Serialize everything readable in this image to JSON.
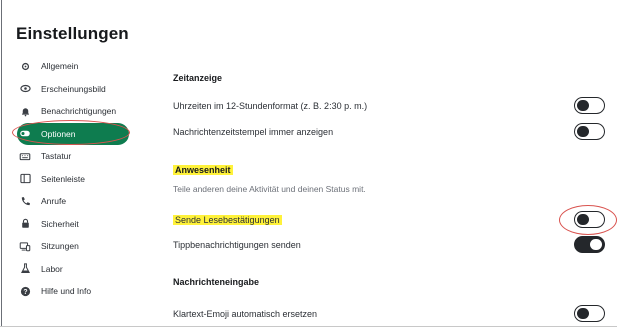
{
  "title": "Einstellungen",
  "nav": [
    {
      "label": "Allgemein",
      "icon": "gear-icon",
      "active": false
    },
    {
      "label": "Erscheinungsbild",
      "icon": "eye-icon",
      "active": false
    },
    {
      "label": "Benachrichtigungen",
      "icon": "bell-icon",
      "active": false
    },
    {
      "label": "Optionen",
      "icon": "toggle-icon",
      "active": true
    },
    {
      "label": "Tastatur",
      "icon": "keyboard-icon",
      "active": false
    },
    {
      "label": "Seitenleiste",
      "icon": "sidebar-icon",
      "active": false
    },
    {
      "label": "Anrufe",
      "icon": "phone-icon",
      "active": false
    },
    {
      "label": "Sicherheit",
      "icon": "lock-icon",
      "active": false
    },
    {
      "label": "Sitzungen",
      "icon": "devices-icon",
      "active": false
    },
    {
      "label": "Labor",
      "icon": "flask-icon",
      "active": false
    },
    {
      "label": "Hilfe und Info",
      "icon": "help-icon",
      "active": false
    }
  ],
  "sections": {
    "zeitanzeige": {
      "title": "Zeitanzeige",
      "rows": [
        {
          "label": "Uhrzeiten im 12-Stundenformat (z. B. 2:30 p. m.)",
          "on": false
        },
        {
          "label": "Nachrichtenzeitstempel immer anzeigen",
          "on": false
        }
      ]
    },
    "anwesenheit": {
      "title": "Anwesenheit",
      "subtitle": "Teile anderen deine Aktivität und deinen Status mit.",
      "rows": [
        {
          "label": "Sende Lesebestätigungen",
          "on": false
        },
        {
          "label": "Tippbenachrichtigungen senden",
          "on": true
        }
      ]
    },
    "nachrichteneingabe": {
      "title": "Nachrichteneingabe",
      "rows": [
        {
          "label": "Klartext-Emoji automatisch ersetzen",
          "on": false
        }
      ]
    }
  },
  "colors": {
    "accent": "#0e7c4f",
    "highlight": "#fff23a",
    "annotation": "#d9534f",
    "toggle": "#24272b"
  }
}
